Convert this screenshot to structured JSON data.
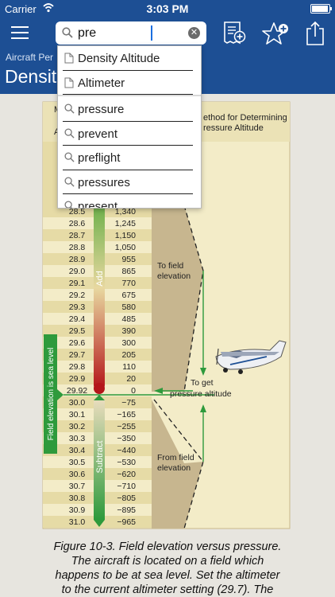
{
  "status_bar": {
    "carrier": "Carrier",
    "time": "3:03 PM"
  },
  "search": {
    "value": "pre"
  },
  "header": {
    "breadcrumb": "Aircraft Per",
    "title": "Densit"
  },
  "suggestions": {
    "documents": [
      {
        "label": "Density Altitude",
        "icon": "document-icon"
      },
      {
        "label": "Altimeter",
        "icon": "document-icon"
      }
    ],
    "terms": [
      {
        "label": "pressure",
        "icon": "search-icon"
      },
      {
        "label": "prevent",
        "icon": "search-icon"
      },
      {
        "label": "preflight",
        "icon": "search-icon"
      },
      {
        "label": "pressures",
        "icon": "search-icon"
      },
      {
        "label": "present",
        "icon": "search-icon"
      }
    ]
  },
  "figure": {
    "header_fragment_left": "M",
    "header_fragment_left2": "A",
    "header_right_line1": "ethod for Determining",
    "header_right_line2": "ressure Altitude",
    "table": [
      [
        "28.5",
        "1,340"
      ],
      [
        "28.6",
        "1,245"
      ],
      [
        "28.7",
        "1,150"
      ],
      [
        "28.8",
        "1,050"
      ],
      [
        "28.9",
        "955"
      ],
      [
        "29.0",
        "865"
      ],
      [
        "29.1",
        "770"
      ],
      [
        "29.2",
        "675"
      ],
      [
        "29.3",
        "580"
      ],
      [
        "29.4",
        "485"
      ],
      [
        "29.5",
        "390"
      ],
      [
        "29.6",
        "300"
      ],
      [
        "29.7",
        "205"
      ],
      [
        "29.8",
        "110"
      ],
      [
        "29.9",
        "20"
      ],
      [
        "29.92",
        "0"
      ],
      [
        "30.0",
        "−75"
      ],
      [
        "30.1",
        "−165"
      ],
      [
        "30.2",
        "−255"
      ],
      [
        "30.3",
        "−350"
      ],
      [
        "30.4",
        "−440"
      ],
      [
        "30.5",
        "−530"
      ],
      [
        "30.6",
        "−620"
      ],
      [
        "30.7",
        "−710"
      ],
      [
        "30.8",
        "−805"
      ],
      [
        "30.9",
        "−895"
      ],
      [
        "31.0",
        "−965"
      ]
    ],
    "add_label": "Add",
    "subtract_label": "Subtract",
    "field_elevation_label": "Field elevation is sea level",
    "to_field_line1": "To field",
    "to_field_line2": "elevation",
    "to_get_line1": "To get",
    "to_get_line2": "pressure altitude",
    "from_field_line1": "From field",
    "from_field_line2": "elevation",
    "colors": {
      "panel": "#f3ecc8",
      "row_alt": "#e6dba6",
      "wedge": "#c7b68f",
      "bar_green": "#2e9a3c",
      "bar_red": "#b4161a"
    }
  },
  "caption": {
    "lines": [
      "Figure 10-3. Field elevation versus pressure.",
      "The aircraft is located on a field which",
      "happens to be at sea level. Set the altimeter",
      "to the current altimeter setting (29.7). The"
    ]
  },
  "colors": {
    "brand_blue": "#1d4f94",
    "page_bg": "#e7e5df"
  }
}
